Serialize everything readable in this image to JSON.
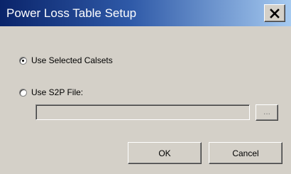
{
  "window": {
    "title": "Power Loss Table Setup",
    "close_label": "close"
  },
  "options": {
    "use_selected_calsets": {
      "label": "Use Selected Calsets",
      "selected": true
    },
    "use_s2p_file": {
      "label": "Use S2P File:",
      "selected": false
    }
  },
  "file": {
    "value": "",
    "browse_label": "..."
  },
  "buttons": {
    "ok": "OK",
    "cancel": "Cancel"
  },
  "colors": {
    "titlebar_start": "#0a246a",
    "titlebar_end": "#a6caf0",
    "dialog_bg": "#d4d0c8"
  }
}
